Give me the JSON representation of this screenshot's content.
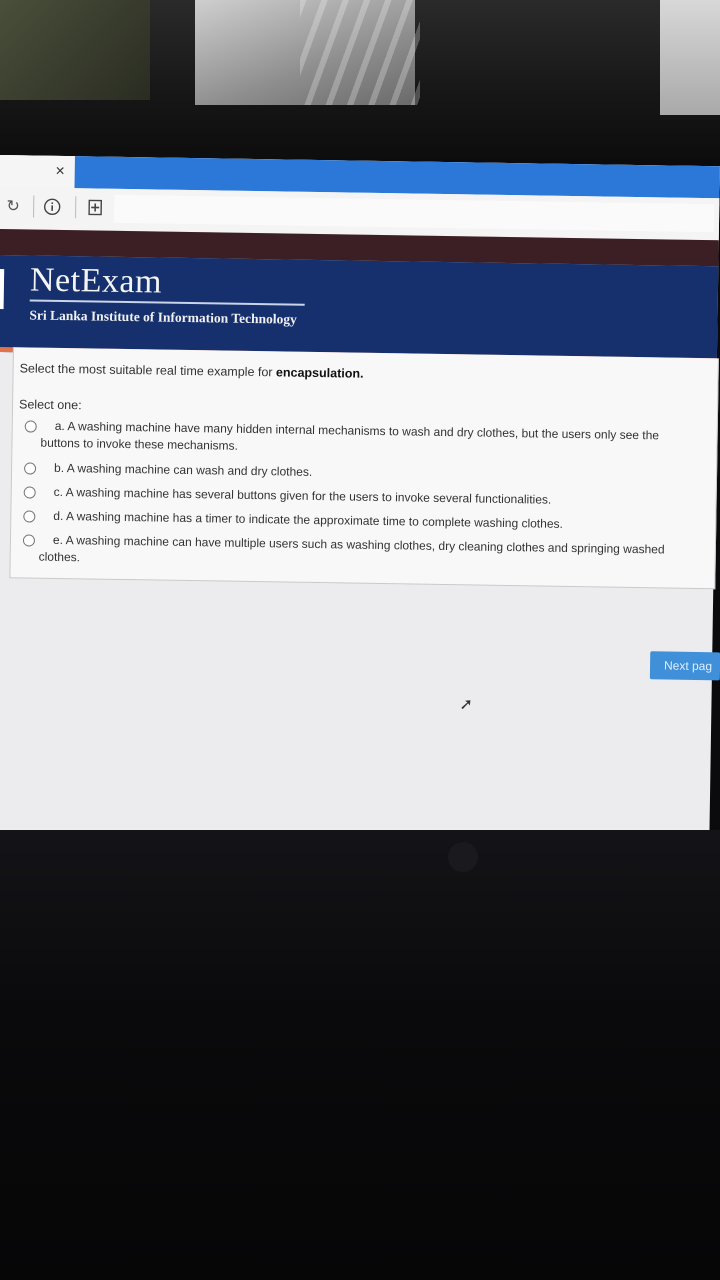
{
  "browser": {
    "close_glyph": "×",
    "icons": [
      "refresh-icon",
      "info-icon",
      "new-tab-icon"
    ]
  },
  "site": {
    "logo_text": "NetExam",
    "subtitle": "Sri Lanka Institute of Information Technology"
  },
  "question": {
    "prompt_prefix": "Select the most suitable real time example for ",
    "prompt_emphasis": "encapsulation.",
    "select_label": "Select one:",
    "options": [
      {
        "text": "a. A washing machine have many hidden internal mechanisms to wash and dry clothes, but the users only see the buttons to invoke these mechanisms.",
        "selected": false
      },
      {
        "text": "b. A washing machine can wash and dry clothes.",
        "selected": false
      },
      {
        "text": "c. A washing machine has several buttons given for the users to invoke several functionalities.",
        "selected": false
      },
      {
        "text": "d. A washing machine has a timer to indicate the approximate time to complete washing clothes.",
        "selected": false
      },
      {
        "text": "e. A washing machine can have multiple users such as washing clothes, dry cleaning clothes and springing washed clothes.",
        "selected": false
      }
    ]
  },
  "navigation": {
    "next_label": "Next pag"
  }
}
